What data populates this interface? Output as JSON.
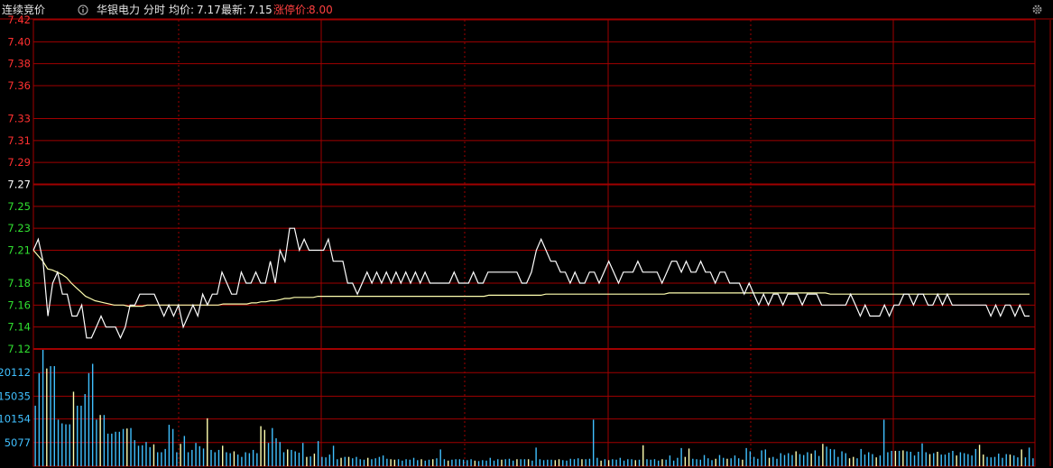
{
  "header": {
    "mode": "连续竞价",
    "info_icon": "info-circle-icon",
    "stock_name": "华银电力",
    "view": "分时",
    "avg_label": "均价:",
    "avg_value": "7.17",
    "latest_label": "最新:",
    "latest_value": "7.15",
    "limit_up_label": "涨停价:",
    "limit_up_value": "8.00",
    "settings_icon": "gear-icon"
  },
  "colors": {
    "price_line": "#ffffff",
    "avg_line": "#ffffb0",
    "grid": "#a00000",
    "price_up_tick": "#ff3030",
    "price_down_tick": "#30e030",
    "volume_tick": "#40c0ff",
    "volume_bar": "#40c0ff",
    "volume_bar_up": "#ffffb0"
  },
  "chart_data": {
    "type": "line",
    "title": "",
    "price_axis": {
      "ylim": [
        7.12,
        7.42
      ],
      "reference": "7.27",
      "ticks": [
        "7.42",
        "7.40",
        "7.38",
        "7.36",
        "7.33",
        "7.31",
        "7.29",
        "7.27",
        "7.25",
        "7.23",
        "7.21",
        "7.18",
        "7.16",
        "7.14",
        "7.12"
      ]
    },
    "volume_axis": {
      "ylim": [
        0,
        25189
      ],
      "ticks": [
        "20112",
        "15035",
        "10154",
        "5077"
      ]
    },
    "series": [
      {
        "key": "price",
        "values": [
          7.21,
          7.22,
          7.2,
          7.15,
          7.18,
          7.19,
          7.17,
          7.17,
          7.15,
          7.15,
          7.16,
          7.13,
          7.13,
          7.14,
          7.15,
          7.14,
          7.14,
          7.14,
          7.13,
          7.14,
          7.16,
          7.16,
          7.17,
          7.17,
          7.17,
          7.17,
          7.16,
          7.15,
          7.16,
          7.15,
          7.16,
          7.14,
          7.15,
          7.16,
          7.15,
          7.17,
          7.16,
          7.17,
          7.17,
          7.19,
          7.18,
          7.17,
          7.17,
          7.19,
          7.18,
          7.18,
          7.19,
          7.18,
          7.18,
          7.2,
          7.18,
          7.21,
          7.2,
          7.23,
          7.23,
          7.21,
          7.22,
          7.21,
          7.21,
          7.21,
          7.21,
          7.22,
          7.2,
          7.2,
          7.2,
          7.18,
          7.18,
          7.17,
          7.18,
          7.19,
          7.18,
          7.19,
          7.18,
          7.19,
          7.18,
          7.19,
          7.18,
          7.19,
          7.18,
          7.19,
          7.18,
          7.19,
          7.18,
          7.18,
          7.18,
          7.18,
          7.18,
          7.19,
          7.18,
          7.18,
          7.18,
          7.19,
          7.18,
          7.18,
          7.19,
          7.19,
          7.19,
          7.19,
          7.19,
          7.19,
          7.19,
          7.18,
          7.18,
          7.19,
          7.21,
          7.22,
          7.21,
          7.2,
          7.2,
          7.19,
          7.19,
          7.18,
          7.19,
          7.18,
          7.18,
          7.19,
          7.19,
          7.18,
          7.19,
          7.2,
          7.19,
          7.18,
          7.19,
          7.19,
          7.19,
          7.2,
          7.19,
          7.19,
          7.19,
          7.19,
          7.18,
          7.19,
          7.2,
          7.2,
          7.19,
          7.2,
          7.19,
          7.19,
          7.2,
          7.19,
          7.19,
          7.18,
          7.19,
          7.19,
          7.18,
          7.18,
          7.18,
          7.17,
          7.18,
          7.17,
          7.16,
          7.17,
          7.16,
          7.17,
          7.17,
          7.16,
          7.17,
          7.17,
          7.17,
          7.16,
          7.17,
          7.17,
          7.17,
          7.16,
          7.16,
          7.16,
          7.16,
          7.16,
          7.16,
          7.17,
          7.16,
          7.15,
          7.16,
          7.15,
          7.15,
          7.15,
          7.16,
          7.15,
          7.16,
          7.16,
          7.17,
          7.17,
          7.16,
          7.17,
          7.17,
          7.16,
          7.16,
          7.17,
          7.16,
          7.17,
          7.16,
          7.16,
          7.16,
          7.16,
          7.16,
          7.16,
          7.16,
          7.16,
          7.15,
          7.16,
          7.15,
          7.16,
          7.16,
          7.15,
          7.16,
          7.15,
          7.15
        ]
      },
      {
        "key": "average",
        "values": [
          7.21,
          7.205,
          7.2,
          7.193,
          7.192,
          7.19,
          7.188,
          7.185,
          7.18,
          7.176,
          7.172,
          7.168,
          7.166,
          7.164,
          7.163,
          7.162,
          7.161,
          7.16,
          7.16,
          7.16,
          7.159,
          7.159,
          7.159,
          7.159,
          7.16,
          7.16,
          7.16,
          7.16,
          7.16,
          7.16,
          7.16,
          7.16,
          7.16,
          7.16,
          7.16,
          7.16,
          7.16,
          7.16,
          7.16,
          7.16,
          7.161,
          7.161,
          7.161,
          7.161,
          7.161,
          7.161,
          7.162,
          7.162,
          7.163,
          7.163,
          7.164,
          7.164,
          7.165,
          7.166,
          7.166,
          7.167,
          7.167,
          7.167,
          7.167,
          7.167,
          7.168,
          7.168,
          7.168,
          7.168,
          7.168,
          7.168,
          7.168,
          7.168,
          7.168,
          7.168,
          7.168,
          7.168,
          7.168,
          7.168,
          7.168,
          7.168,
          7.168,
          7.168,
          7.168,
          7.168,
          7.168,
          7.168,
          7.168,
          7.168,
          7.168,
          7.168,
          7.168,
          7.168,
          7.168,
          7.168,
          7.168,
          7.168,
          7.168,
          7.168,
          7.168,
          7.168,
          7.169,
          7.169,
          7.169,
          7.169,
          7.169,
          7.169,
          7.169,
          7.169,
          7.169,
          7.169,
          7.169,
          7.169,
          7.17,
          7.17,
          7.17,
          7.17,
          7.17,
          7.17,
          7.17,
          7.17,
          7.17,
          7.17,
          7.17,
          7.17,
          7.17,
          7.17,
          7.17,
          7.17,
          7.17,
          7.17,
          7.17,
          7.17,
          7.17,
          7.17,
          7.17,
          7.17,
          7.17,
          7.17,
          7.171,
          7.171,
          7.171,
          7.171,
          7.171,
          7.171,
          7.171,
          7.171,
          7.171,
          7.171,
          7.171,
          7.171,
          7.171,
          7.171,
          7.171,
          7.171,
          7.171,
          7.171,
          7.171,
          7.171,
          7.171,
          7.171,
          7.171,
          7.171,
          7.171,
          7.171,
          7.171,
          7.171,
          7.171,
          7.171,
          7.171,
          7.171,
          7.171,
          7.171,
          7.17,
          7.17,
          7.17,
          7.17,
          7.17,
          7.17,
          7.17,
          7.17,
          7.17,
          7.17,
          7.17,
          7.17,
          7.17,
          7.17,
          7.17,
          7.17,
          7.17,
          7.17,
          7.17,
          7.17,
          7.17,
          7.17,
          7.17,
          7.17,
          7.17,
          7.17,
          7.17,
          7.17,
          7.17,
          7.17,
          7.17,
          7.17,
          7.17,
          7.17,
          7.17,
          7.17,
          7.17,
          7.17,
          7.17,
          7.17,
          7.17,
          7.17,
          7.17
        ]
      },
      {
        "key": "volume",
        "values": [
          13000,
          20000,
          25000,
          21000,
          21500,
          21500,
          10000,
          9200,
          9000,
          9000,
          16000,
          13000,
          13000,
          15500,
          20000,
          22000,
          10000,
          11000,
          11000,
          7000,
          7000,
          7400,
          7400,
          8000,
          8100,
          8200,
          5600,
          4400,
          4500,
          5200,
          4100,
          4700,
          3000,
          3000,
          3700,
          8900,
          8000,
          3000,
          4800,
          6500,
          3000,
          3500,
          5000,
          4300,
          3800,
          10300,
          3500,
          3000,
          3500,
          4400,
          3000,
          2800,
          3200,
          2500,
          2000,
          3000,
          2800,
          3500,
          2800,
          8600,
          7800,
          5000,
          8200,
          6000,
          5200,
          3000,
          3600,
          3500,
          3200,
          2900,
          5000,
          2000,
          2100,
          2700,
          5400,
          2000,
          1900,
          2500,
          4400,
          1500,
          1800,
          2000,
          2000,
          1700,
          2000,
          1500,
          1400,
          1800,
          1500,
          1700,
          2000,
          2300,
          1600,
          1500,
          1400,
          1500,
          1200,
          1500,
          1400,
          1800,
          1300,
          1500,
          1200,
          1400,
          1500,
          1700,
          3600,
          1500,
          1200,
          1400,
          1500,
          1500,
          1400,
          1300,
          1500,
          1200,
          1100,
          1300,
          1200,
          1800,
          1200,
          1500,
          1400,
          1500,
          1600,
          1200,
          1500,
          1500,
          1500,
          1500,
          1200,
          4000,
          1500,
          1300,
          1400,
          1400,
          1300,
          1500,
          1300,
          1200,
          1600,
          1500,
          1700,
          1500,
          1500,
          1600,
          10000,
          1800,
          1200,
          1500,
          1300,
          1500,
          1400,
          1800,
          1200,
          1500,
          1500,
          1300,
          1400,
          4500,
          1500,
          1400,
          1500,
          1200,
          1500,
          1400,
          2300,
          1200,
          1800,
          3900,
          2000,
          3800,
          1600,
          1500,
          1400,
          2400,
          1700,
          1300,
          1600,
          2400,
          1800,
          1600,
          1700,
          2300,
          1700,
          1400,
          3900,
          3200,
          2000,
          1600,
          3400,
          3600,
          1800,
          2000,
          1600,
          2800,
          2400,
          2800,
          2400,
          3200,
          2600,
          2400,
          3000,
          2700,
          3400,
          2200,
          4800,
          4200,
          3700,
          3600,
          2000,
          3200,
          2800,
          1700,
          2000,
          1700,
          3700,
          2500,
          3000,
          2600,
          1900,
          2300,
          10000,
          3000,
          3300,
          3300,
          3300,
          3400,
          3200,
          3100,
          2300,
          3100,
          4900,
          3000,
          2600,
          2800,
          3100,
          2500,
          2500,
          2900,
          3300,
          2300,
          3000,
          2800,
          2600,
          2300,
          3700,
          4600,
          2500,
          2000,
          1900,
          2000,
          2700,
          1800,
          2600,
          2500,
          2300,
          1900,
          3600,
          1900,
          4000,
          1700
        ]
      }
    ]
  }
}
